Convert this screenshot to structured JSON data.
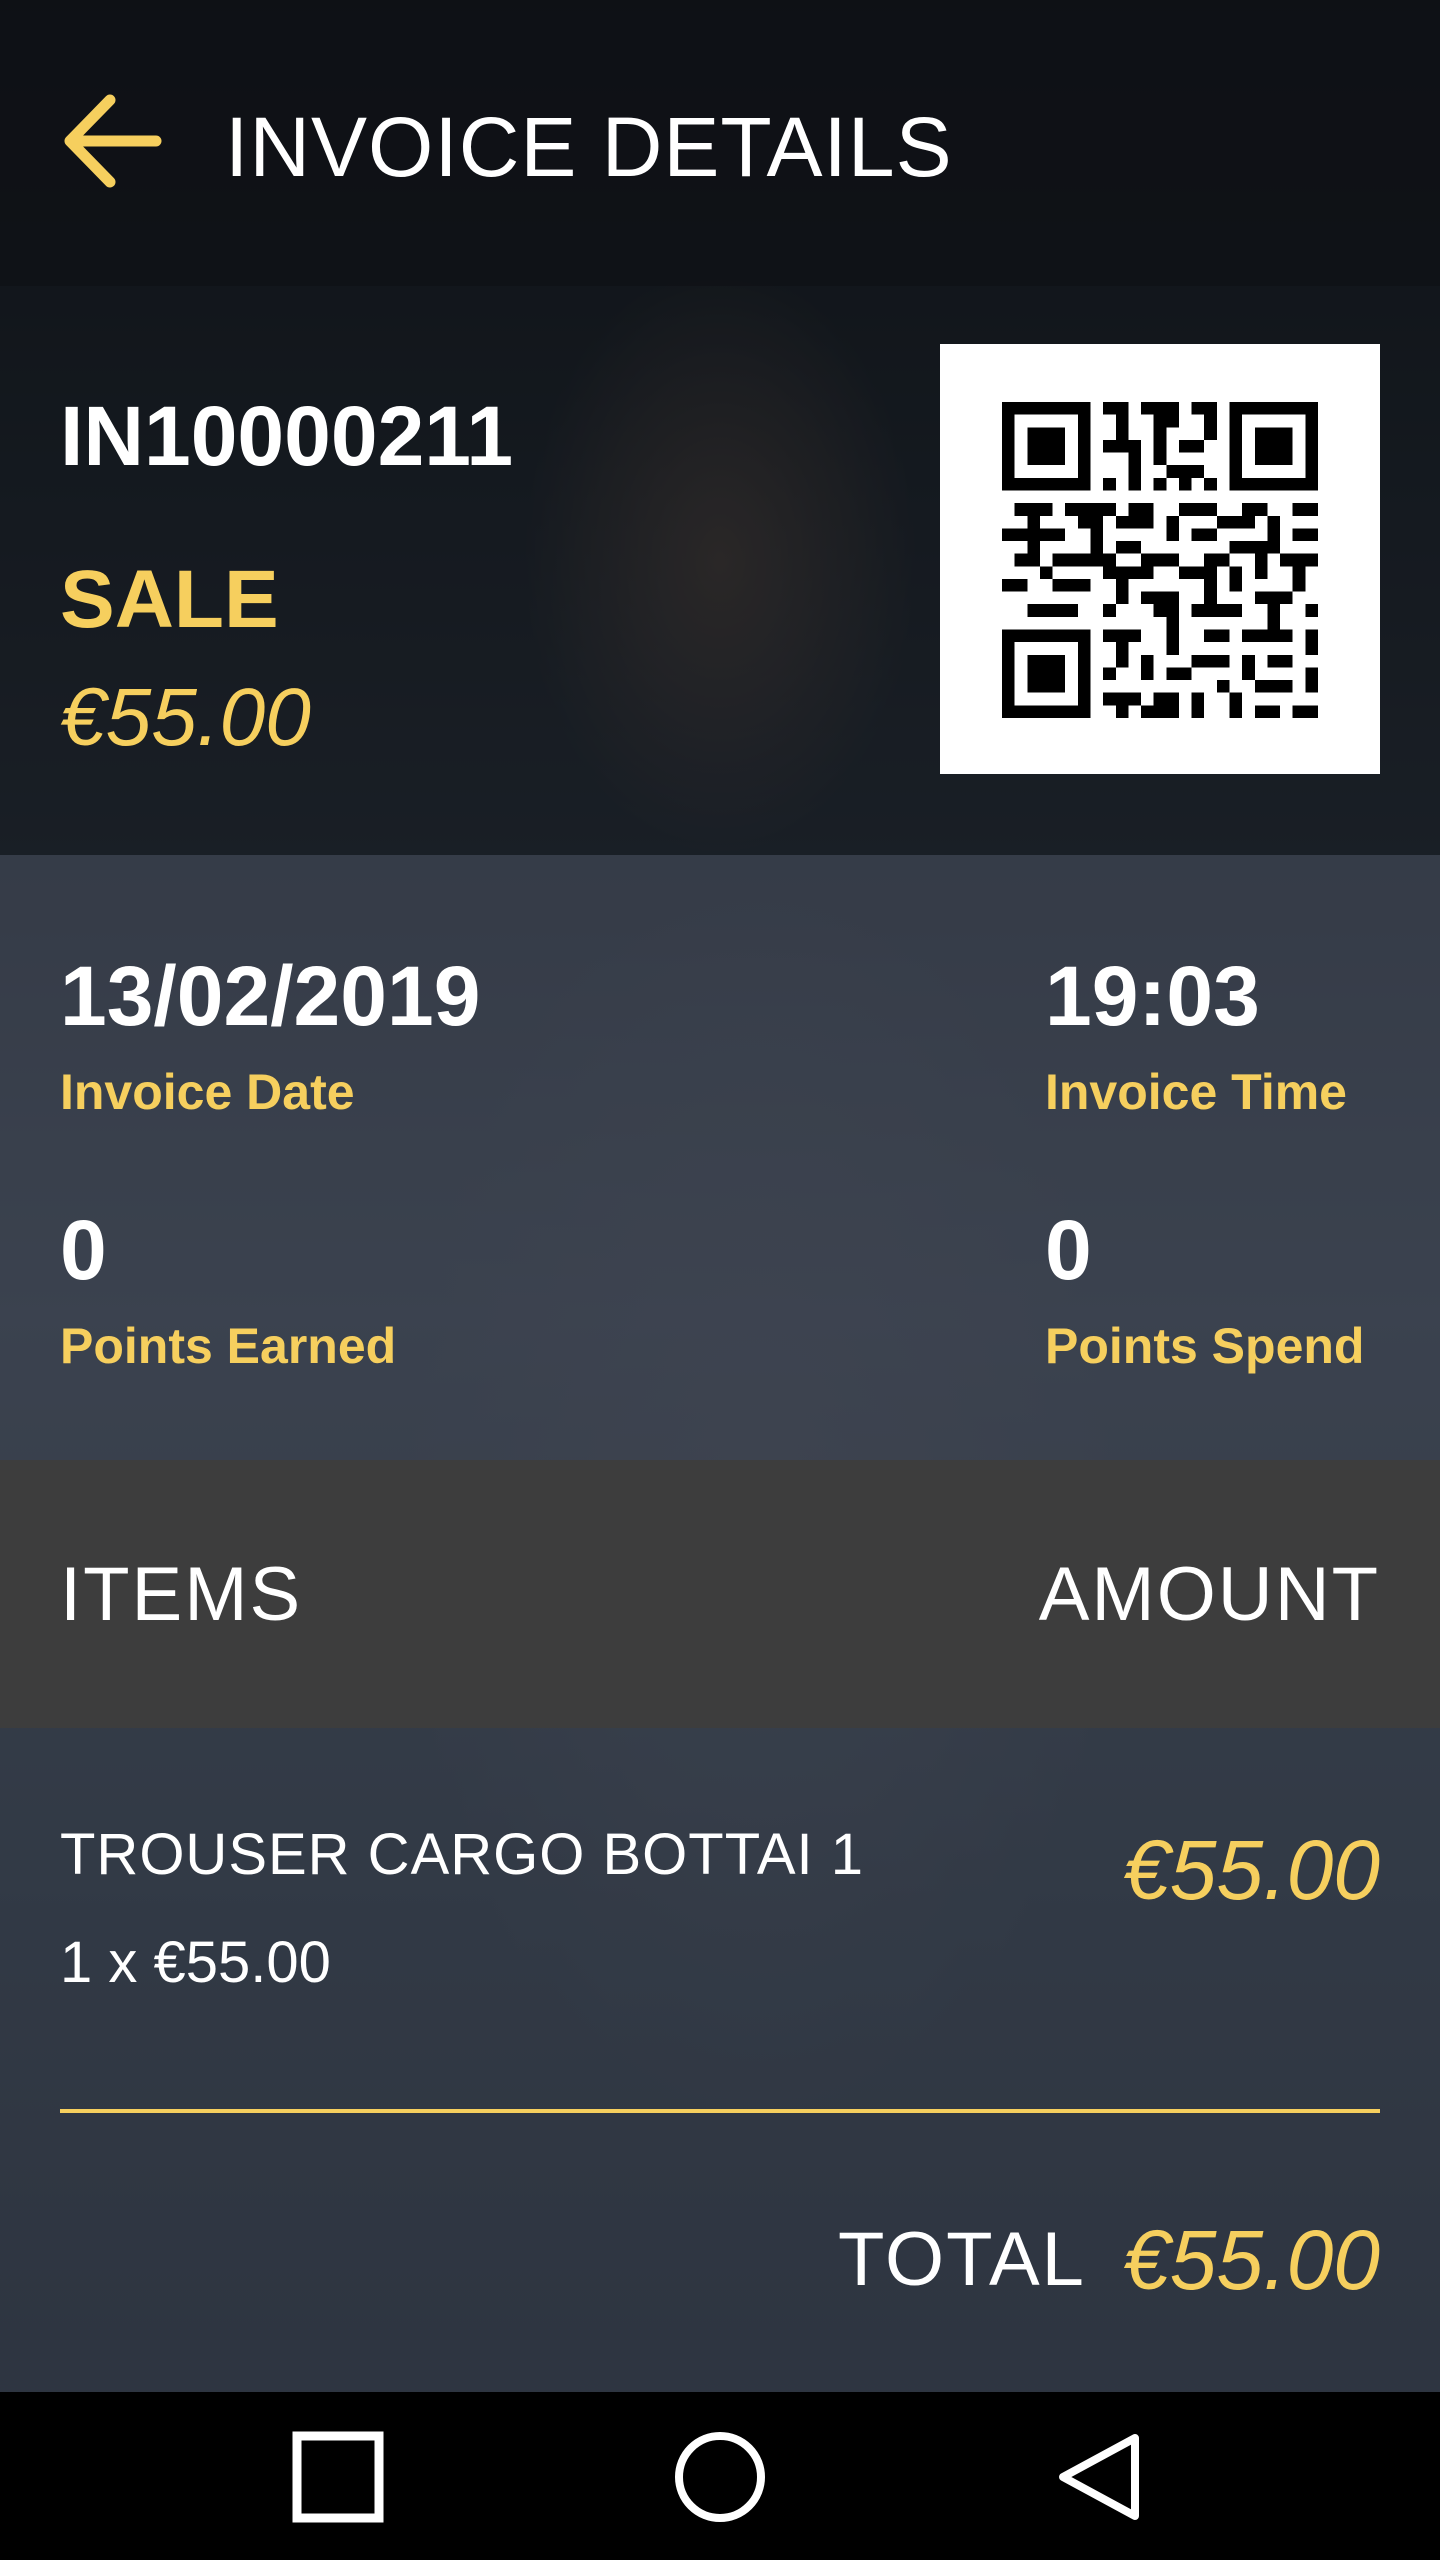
{
  "header": {
    "title": "INVOICE DETAILS",
    "back_icon": "arrow-left-icon"
  },
  "invoice": {
    "number": "IN10000211",
    "type": "SALE",
    "amount": "€55.00",
    "qr_icon": "qr-code"
  },
  "details": {
    "date_value": "13/02/2019",
    "date_label": "Invoice Date",
    "time_value": "19:03",
    "time_label": "Invoice Time",
    "points_earned_value": "0",
    "points_earned_label": "Points Earned",
    "points_spend_value": "0",
    "points_spend_label": "Points Spend"
  },
  "items_table": {
    "col_items": "ITEMS",
    "col_amount": "AMOUNT",
    "items": [
      {
        "name": "TROUSER CARGO BOTTAI 1",
        "qty_line": "1 x €55.00",
        "amount": "€55.00"
      }
    ],
    "total_label": "TOTAL",
    "total_amount": "€55.00"
  },
  "navbar": {
    "recents_icon": "square-icon",
    "home_icon": "circle-icon",
    "back_icon": "triangle-back-icon"
  },
  "colors": {
    "accent": "#f6cf5e",
    "header_bg": "#0e1014",
    "items_header_bg": "#3d3d3d"
  }
}
